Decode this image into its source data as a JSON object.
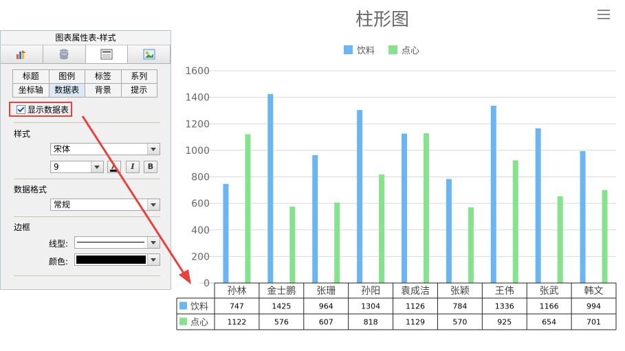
{
  "chart_data": {
    "type": "bar",
    "title": "柱形图",
    "categories": [
      "孙林",
      "金士鹏",
      "张珊",
      "孙阳",
      "袁成洁",
      "张颖",
      "王伟",
      "张武",
      "韩文"
    ],
    "series": [
      {
        "name": "饮料",
        "color": "#6bb5f2",
        "values": [
          747,
          1425,
          964,
          1304,
          1126,
          784,
          1336,
          1166,
          994
        ]
      },
      {
        "name": "点心",
        "color": "#86e28f",
        "values": [
          1122,
          576,
          607,
          818,
          1129,
          570,
          925,
          654,
          701
        ]
      }
    ],
    "ylim": [
      0,
      1600
    ],
    "yticks": [
      0,
      200,
      400,
      600,
      800,
      1000,
      1200,
      1400,
      1600
    ],
    "grid": true,
    "legend": "top-center",
    "data_table": true
  },
  "panel": {
    "title": "图表属性表-样式",
    "icon_tabs": [
      "chart-type-icon",
      "data-source-icon",
      "style-icon",
      "effect-icon"
    ],
    "sub_tabs_row1": [
      "标题",
      "图例",
      "标签",
      "系列"
    ],
    "sub_tabs_row2": [
      "坐标轴",
      "数据表",
      "背景",
      "提示"
    ],
    "active_sub_tab": "数据表",
    "show_table_label": "显示数据表",
    "style_heading": "样式",
    "font_name": "宋体",
    "font_size": "9",
    "btn_italic": "I",
    "btn_bold": "B",
    "data_format_heading": "数据格式",
    "data_format_value": "常规",
    "border_heading": "边框",
    "line_type_label": "线型:",
    "color_label": "颜色:",
    "border_color": "#000000"
  },
  "annotation": {
    "arrow_color": "#e8413b"
  }
}
